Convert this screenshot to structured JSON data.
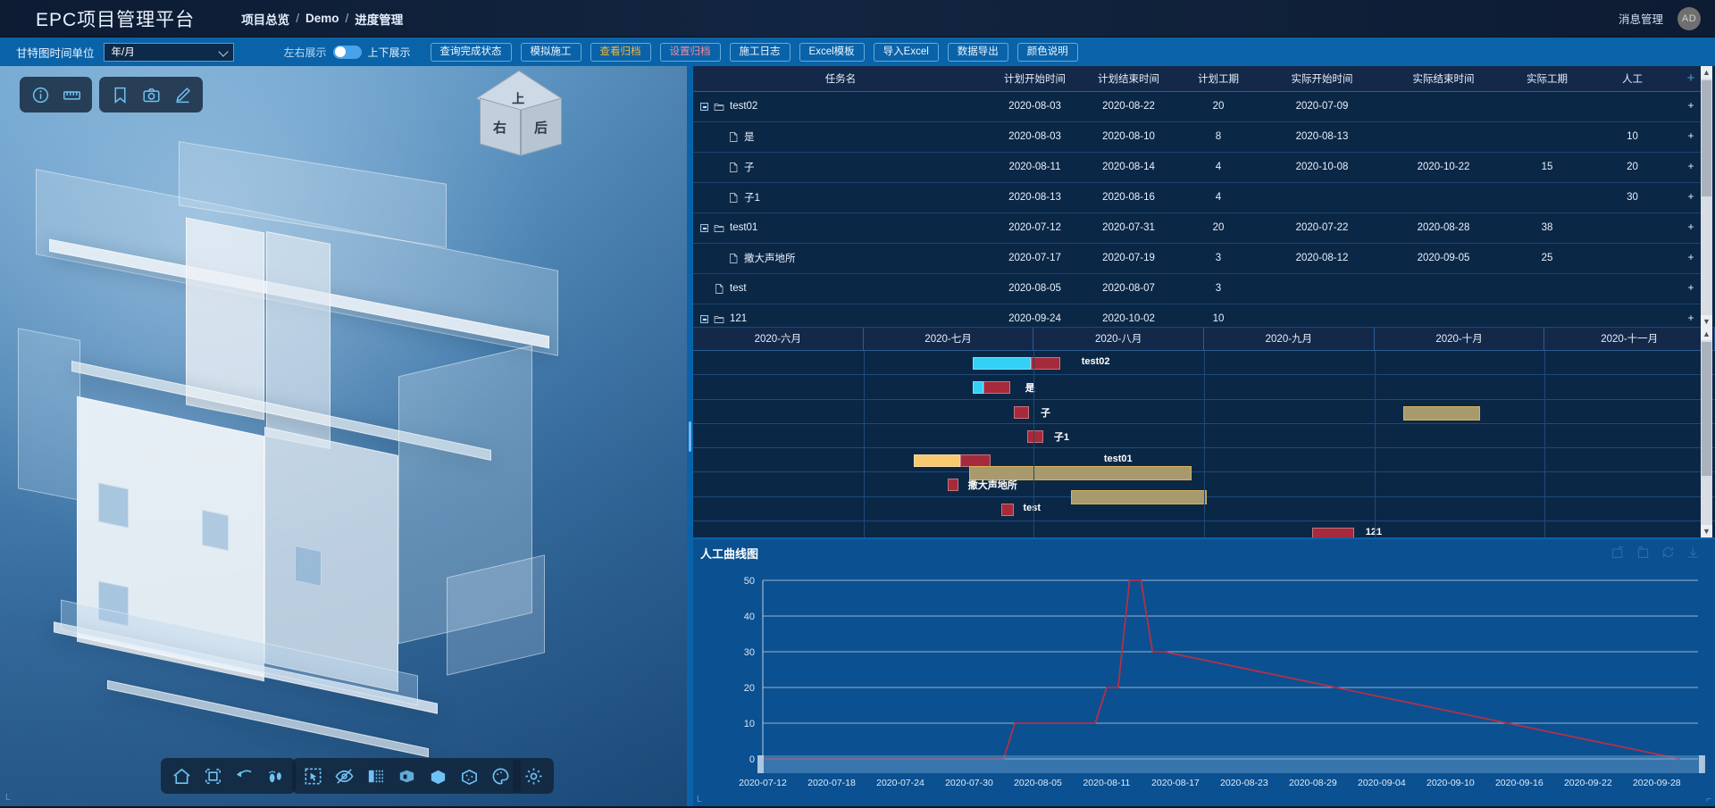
{
  "header": {
    "brand": "EPC项目管理平台",
    "breadcrumbs": [
      "项目总览",
      "Demo",
      "进度管理"
    ],
    "separator": "/",
    "messages_label": "消息管理",
    "avatar_initials": "AD"
  },
  "toolbar": {
    "time_unit_label": "甘特图时间单位",
    "time_unit_value": "年/月",
    "toggle_left_label": "左右展示",
    "toggle_right_label": "上下展示",
    "toggle_state": "left",
    "buttons": [
      {
        "label": "查询完成状态",
        "style": "default"
      },
      {
        "label": "模拟施工",
        "style": "default"
      },
      {
        "label": "查看归档",
        "style": "orange"
      },
      {
        "label": "设置归档",
        "style": "pink"
      },
      {
        "label": "施工日志",
        "style": "default"
      },
      {
        "label": "Excel模板",
        "style": "default"
      },
      {
        "label": "导入Excel",
        "style": "default"
      },
      {
        "label": "数据导出",
        "style": "default"
      },
      {
        "label": "颜色说明",
        "style": "default"
      }
    ]
  },
  "viewport": {
    "view_cube": {
      "top": "上",
      "left": "右",
      "right": "后"
    },
    "toolbar_top_left": [
      {
        "icon": "info-icon"
      },
      {
        "icon": "ruler-icon"
      }
    ],
    "toolbar_top_left2": [
      {
        "icon": "bookmark-icon"
      },
      {
        "icon": "camera-icon"
      },
      {
        "icon": "pencil-icon"
      }
    ],
    "toolbar_bottom1": [
      {
        "icon": "home-icon"
      },
      {
        "icon": "fit-screen-icon"
      },
      {
        "icon": "undo-icon"
      },
      {
        "icon": "walk-icon"
      }
    ],
    "toolbar_bottom2": [
      {
        "icon": "select-box-icon"
      },
      {
        "icon": "hide-eye-icon"
      },
      {
        "icon": "section-icon"
      },
      {
        "icon": "explode-icon"
      },
      {
        "icon": "solid-box-icon"
      },
      {
        "icon": "transparent-box-icon"
      },
      {
        "icon": "palette-icon"
      }
    ],
    "toolbar_bottom3": [
      {
        "icon": "settings-gear-icon"
      }
    ]
  },
  "task_table": {
    "columns": [
      "任务名",
      "计划开始时间",
      "计划结束时间",
      "计划工期",
      "实际开始时间",
      "实际结束时间",
      "实际工期",
      "人工",
      "+"
    ],
    "rows": [
      {
        "level": 0,
        "type": "folder",
        "expandable": true,
        "name": "test02",
        "plan_start": "2020-08-03",
        "plan_end": "2020-08-22",
        "plan_dur": "20",
        "act_start": "2020-07-09",
        "act_end": "",
        "act_dur": "",
        "labor": ""
      },
      {
        "level": 1,
        "type": "file",
        "expandable": false,
        "name": "是",
        "plan_start": "2020-08-03",
        "plan_end": "2020-08-10",
        "plan_dur": "8",
        "act_start": "2020-08-13",
        "act_end": "",
        "act_dur": "",
        "labor": "10"
      },
      {
        "level": 1,
        "type": "file",
        "expandable": false,
        "name": "子",
        "plan_start": "2020-08-11",
        "plan_end": "2020-08-14",
        "plan_dur": "4",
        "act_start": "2020-10-08",
        "act_end": "2020-10-22",
        "act_dur": "15",
        "labor": "20"
      },
      {
        "level": 1,
        "type": "file",
        "expandable": false,
        "name": "子1",
        "plan_start": "2020-08-13",
        "plan_end": "2020-08-16",
        "plan_dur": "4",
        "act_start": "",
        "act_end": "",
        "act_dur": "",
        "labor": "30"
      },
      {
        "level": 0,
        "type": "folder",
        "expandable": true,
        "name": "test01",
        "plan_start": "2020-07-12",
        "plan_end": "2020-07-31",
        "plan_dur": "20",
        "act_start": "2020-07-22",
        "act_end": "2020-08-28",
        "act_dur": "38",
        "labor": ""
      },
      {
        "level": 1,
        "type": "file",
        "expandable": false,
        "name": "撒大声地所",
        "plan_start": "2020-07-17",
        "plan_end": "2020-07-19",
        "plan_dur": "3",
        "act_start": "2020-08-12",
        "act_end": "2020-09-05",
        "act_dur": "25",
        "labor": ""
      },
      {
        "level": 0,
        "type": "file",
        "expandable": false,
        "name": "test",
        "plan_start": "2020-08-05",
        "plan_end": "2020-08-07",
        "plan_dur": "3",
        "act_start": "",
        "act_end": "",
        "act_dur": "",
        "labor": ""
      },
      {
        "level": 0,
        "type": "folder",
        "expandable": true,
        "name": "121",
        "plan_start": "2020-09-24",
        "plan_end": "2020-10-02",
        "plan_dur": "10",
        "act_start": "",
        "act_end": "",
        "act_dur": "",
        "labor": ""
      }
    ],
    "add_symbol": "+"
  },
  "gantt": {
    "month_columns": [
      "2020-六月",
      "2020-七月",
      "2020-八月",
      "2020-九月",
      "2020-十月",
      "2020-十一月"
    ],
    "bars": [
      {
        "row": 0,
        "label": "test02",
        "segments": [
          {
            "kind": "plan",
            "color": "#34d0f5",
            "left_pct": 27.4,
            "width_pct": 5.6
          },
          {
            "kind": "actual",
            "color": "#a52a3c",
            "left_pct": 33.0,
            "width_pct": 2.9
          }
        ],
        "label_pct": 38.0
      },
      {
        "row": 1,
        "label": "是",
        "segments": [
          {
            "kind": "plan",
            "color": "#34d0f5",
            "left_pct": 27.4,
            "width_pct": 1.0
          },
          {
            "kind": "actual",
            "color": "#a52a3c",
            "left_pct": 28.4,
            "width_pct": 2.6
          }
        ],
        "label_pct": 32.5
      },
      {
        "row": 2,
        "label": "子",
        "segments": [
          {
            "kind": "actual",
            "color": "#a52a3c",
            "left_pct": 31.4,
            "width_pct": 1.5
          }
        ],
        "label_pct": 34.0
      },
      {
        "row": 2,
        "label": "",
        "segments": [
          {
            "kind": "khaki",
            "color": "#a89a6c",
            "left_pct": 69.5,
            "width_pct": 7.5
          }
        ],
        "label_pct": -1
      },
      {
        "row": 3,
        "label": "子1",
        "segments": [
          {
            "kind": "actual",
            "color": "#a52a3c",
            "left_pct": 32.7,
            "width_pct": 1.6
          }
        ],
        "label_pct": 35.3
      },
      {
        "row": 4,
        "label": "test01",
        "segments": [
          {
            "kind": "plan",
            "color": "#f8c96e",
            "left_pct": 21.6,
            "width_pct": 4.5
          },
          {
            "kind": "actual",
            "color": "#a52a3c",
            "left_pct": 26.1,
            "width_pct": 3.0
          }
        ],
        "label_pct": 40.2
      },
      {
        "row": 4,
        "label": "",
        "segments": [
          {
            "kind": "khaki",
            "color": "#a89a6c",
            "left_pct": 27.0,
            "width_pct": 21.8
          }
        ],
        "label_pct": -1,
        "offset": 20
      },
      {
        "row": 5,
        "label": "撒大声地所",
        "segments": [
          {
            "kind": "actual",
            "color": "#a52a3c",
            "left_pct": 24.9,
            "width_pct": 1.1
          }
        ],
        "label_pct": 26.9
      },
      {
        "row": 5,
        "label": "",
        "segments": [
          {
            "kind": "khaki",
            "color": "#a89a6c",
            "left_pct": 37.0,
            "width_pct": 13.3
          }
        ],
        "label_pct": -1,
        "offset": 20
      },
      {
        "row": 6,
        "label": "test",
        "segments": [
          {
            "kind": "actual",
            "color": "#a52a3c",
            "left_pct": 30.2,
            "width_pct": 1.2
          }
        ],
        "label_pct": 32.3
      },
      {
        "row": 7,
        "label": "121",
        "segments": [
          {
            "kind": "actual",
            "color": "#a52a3c",
            "left_pct": 60.6,
            "width_pct": 4.1
          }
        ],
        "label_pct": 65.8
      }
    ]
  },
  "chart_data": {
    "type": "line",
    "title": "人工曲线图",
    "xlabel": "",
    "ylabel": "",
    "ylim": [
      0,
      50
    ],
    "yticks": [
      0,
      10,
      20,
      30,
      40,
      50
    ],
    "grid": true,
    "legend": "none",
    "line_color": "#b3304a",
    "xticks": [
      "2020-07-12",
      "2020-07-18",
      "2020-07-24",
      "2020-07-30",
      "2020-08-05",
      "2020-08-11",
      "2020-08-17",
      "2020-08-23",
      "2020-08-29",
      "2020-09-04",
      "2020-09-10",
      "2020-09-16",
      "2020-09-22",
      "2020-09-28"
    ],
    "x": [
      "2020-07-12",
      "2020-08-02",
      "2020-08-03",
      "2020-08-10",
      "2020-08-11",
      "2020-08-12",
      "2020-08-13",
      "2020-08-14",
      "2020-08-15",
      "2020-08-16",
      "2020-09-30"
    ],
    "values": [
      0,
      0,
      10,
      10,
      20,
      20,
      50,
      50,
      30,
      30,
      0
    ],
    "series": [
      {
        "name": "人工",
        "values": [
          0,
          0,
          10,
          10,
          20,
          20,
          50,
          50,
          30,
          30,
          0
        ]
      }
    ],
    "toolbox": [
      "zoom-area-icon",
      "zoom-restore-icon",
      "refresh-icon",
      "download-icon"
    ]
  }
}
